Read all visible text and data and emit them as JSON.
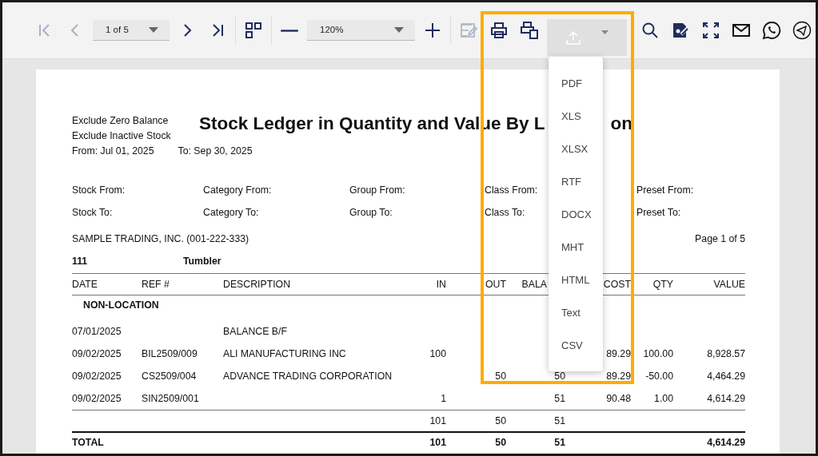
{
  "toolbar": {
    "items": [
      {
        "kind": "first",
        "disabled": true
      },
      {
        "kind": "prev",
        "disabled": true
      },
      {
        "kind": "page-select",
        "value": "1 of 5"
      },
      {
        "kind": "next",
        "disabled": false
      },
      {
        "kind": "last",
        "disabled": false
      },
      {
        "kind": "separator"
      },
      {
        "kind": "multipage",
        "disabled": false
      },
      {
        "kind": "separator"
      },
      {
        "kind": "zoom-out",
        "disabled": false
      },
      {
        "kind": "zoom-select",
        "value": "120%"
      },
      {
        "kind": "zoom-in",
        "disabled": false
      },
      {
        "kind": "separator"
      },
      {
        "kind": "edit",
        "disabled": true
      },
      {
        "kind": "print",
        "disabled": false
      },
      {
        "kind": "print-page",
        "disabled": false
      },
      {
        "kind": "export",
        "disabled": true,
        "expanded": true
      },
      {
        "kind": "separator"
      },
      {
        "kind": "search",
        "disabled": false
      },
      {
        "kind": "parameters",
        "disabled": false
      },
      {
        "kind": "fullscreen",
        "disabled": false
      },
      {
        "kind": "email",
        "disabled": false
      },
      {
        "kind": "whatsapp",
        "disabled": false
      },
      {
        "kind": "telegram",
        "disabled": false
      }
    ]
  },
  "export_menu": [
    "PDF",
    "XLS",
    "XLSX",
    "RTF",
    "DOCX",
    "MHT",
    "HTML",
    "Text",
    "CSV"
  ],
  "report": {
    "options": [
      "Exclude Zero Balance",
      "Exclude Inactive Stock"
    ],
    "period": [
      "From: Jul 01, 2025",
      "To: Sep 30, 2025"
    ],
    "title_parts": [
      "Stock Ledger in Quantity and Value By L",
      "on"
    ],
    "filters": [
      [
        "Stock From:",
        "Category From:",
        "Group From:",
        "Class From:",
        "Preset From:"
      ],
      [
        "Stock To:",
        "Category To:",
        "Group To:",
        "Class To:",
        "Preset To:"
      ]
    ],
    "company": "SAMPLE TRADING, INC. (001-222-333)",
    "page": "Page 1 of 5",
    "item_code": "111",
    "item_name": "Tumbler",
    "columns": [
      "DATE",
      "REF #",
      "DESCRIPTION",
      "IN",
      "OUT",
      "BALA",
      "COST",
      "QTY",
      "VALUE"
    ],
    "location": "NON-LOCATION",
    "rows": [
      {
        "date": "07/01/2025",
        "description": "BALANCE B/F"
      },
      {
        "date": "09/02/2025",
        "ref": "BIL2509/009",
        "description": "ALI MANUFACTURING INC",
        "in": "100",
        "cost": "89.29",
        "qty": "100.00",
        "value": "8,928.57"
      },
      {
        "date": "09/02/2025",
        "ref": "CS2509/004",
        "description": "ADVANCE TRADING CORPORATION",
        "out": "50",
        "balance": "50",
        "cost": "89.29",
        "qty": "-50.00",
        "value": "4,464.29"
      },
      {
        "date": "09/02/2025",
        "ref": "SIN2509/001",
        "in": "1",
        "balance": "51",
        "cost": "90.48",
        "qty": "1.00",
        "value": "4,614.29"
      }
    ],
    "subtotal": {
      "in": "101",
      "out": "50",
      "balance": "51"
    },
    "total": {
      "date": "TOTAL",
      "in": "101",
      "out": "50",
      "balance": "51",
      "value": "4,614.29"
    }
  }
}
